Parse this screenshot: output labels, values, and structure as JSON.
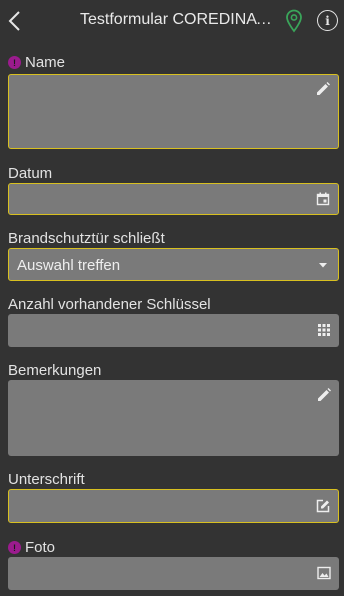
{
  "header": {
    "title": "Testformular COREDINATE Form",
    "back_icon": "chevron-left-icon",
    "location_icon": "map-pin-icon",
    "info_icon": "info-icon",
    "info_glyph": "i"
  },
  "fields": {
    "name": {
      "label": "Name",
      "required": true,
      "required_glyph": "!",
      "icon": "pencil-icon"
    },
    "datum": {
      "label": "Datum",
      "icon": "calendar-icon"
    },
    "brandschutz": {
      "label": "Brandschutztür schließt",
      "value": "Auswahl treffen",
      "icon": "dropdown-arrow-icon"
    },
    "schluessel": {
      "label": "Anzahl vorhandener Schlüssel",
      "icon": "number-pad-icon"
    },
    "bemerkungen": {
      "label": "Bemerkungen",
      "icon": "pencil-icon"
    },
    "unterschrift": {
      "label": "Unterschrift",
      "icon": "signature-edit-icon"
    },
    "foto": {
      "label": "Foto",
      "required": true,
      "required_glyph": "!",
      "icon": "image-icon"
    }
  },
  "colors": {
    "background": "#333333",
    "field": "#7a7a7a",
    "focus_border": "#d8c020",
    "required_badge": "#9b1b8e",
    "pin": "#3aa55a"
  }
}
